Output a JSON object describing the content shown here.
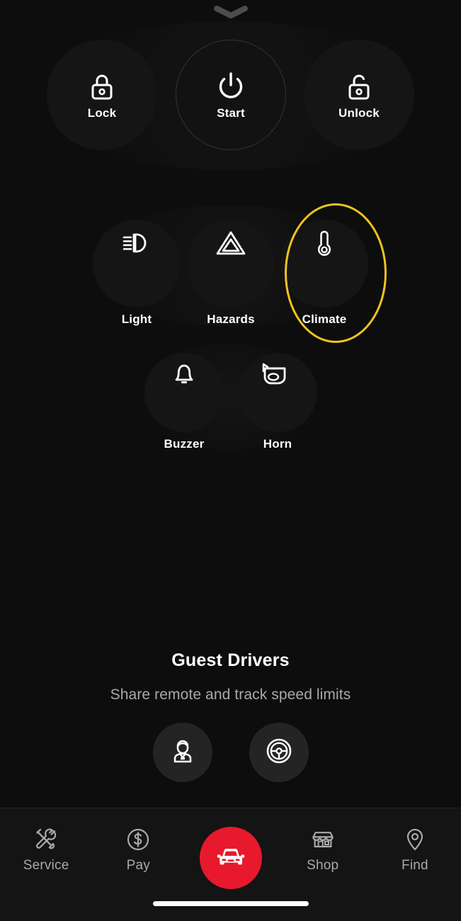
{
  "theme": {
    "background": "#0d0d0d",
    "surface": "#151515",
    "nav_background": "#141414",
    "accent_red": "#e8192c",
    "highlight_yellow": "#efc320",
    "text_primary": "#ffffff",
    "text_secondary": "#a9a9a9"
  },
  "drag_handle": {
    "icon": "chevron-down-icon"
  },
  "primary_controls": [
    {
      "id": "lock",
      "label": "Lock",
      "icon": "lock-closed-icon"
    },
    {
      "id": "start",
      "label": "Start",
      "icon": "power-icon"
    },
    {
      "id": "unlock",
      "label": "Unlock",
      "icon": "lock-open-icon"
    }
  ],
  "secondary_controls": [
    {
      "id": "light",
      "label": "Light",
      "icon": "headlight-icon"
    },
    {
      "id": "hazards",
      "label": "Hazards",
      "icon": "hazard-triangle-icon"
    },
    {
      "id": "climate",
      "label": "Climate",
      "icon": "thermometer-icon",
      "highlighted": true
    }
  ],
  "tertiary_controls": [
    {
      "id": "buzzer",
      "label": "Buzzer",
      "icon": "bell-icon"
    },
    {
      "id": "horn",
      "label": "Horn",
      "icon": "horn-icon"
    }
  ],
  "guest_drivers": {
    "title": "Guest Drivers",
    "subtitle": "Share remote and track speed limits",
    "actions": [
      {
        "id": "valet",
        "icon": "valet-person-icon"
      },
      {
        "id": "steering-wheel",
        "icon": "steering-wheel-icon"
      }
    ]
  },
  "bottom_nav": {
    "items": [
      {
        "id": "service",
        "label": "Service",
        "icon": "tools-icon",
        "active": false
      },
      {
        "id": "pay",
        "label": "Pay",
        "icon": "dollar-circle-icon",
        "active": false
      },
      {
        "id": "car",
        "label": "",
        "icon": "car-front-icon",
        "active": true
      },
      {
        "id": "shop",
        "label": "Shop",
        "icon": "storefront-icon",
        "active": false
      },
      {
        "id": "find",
        "label": "Find",
        "icon": "map-pin-icon",
        "active": false
      }
    ]
  }
}
